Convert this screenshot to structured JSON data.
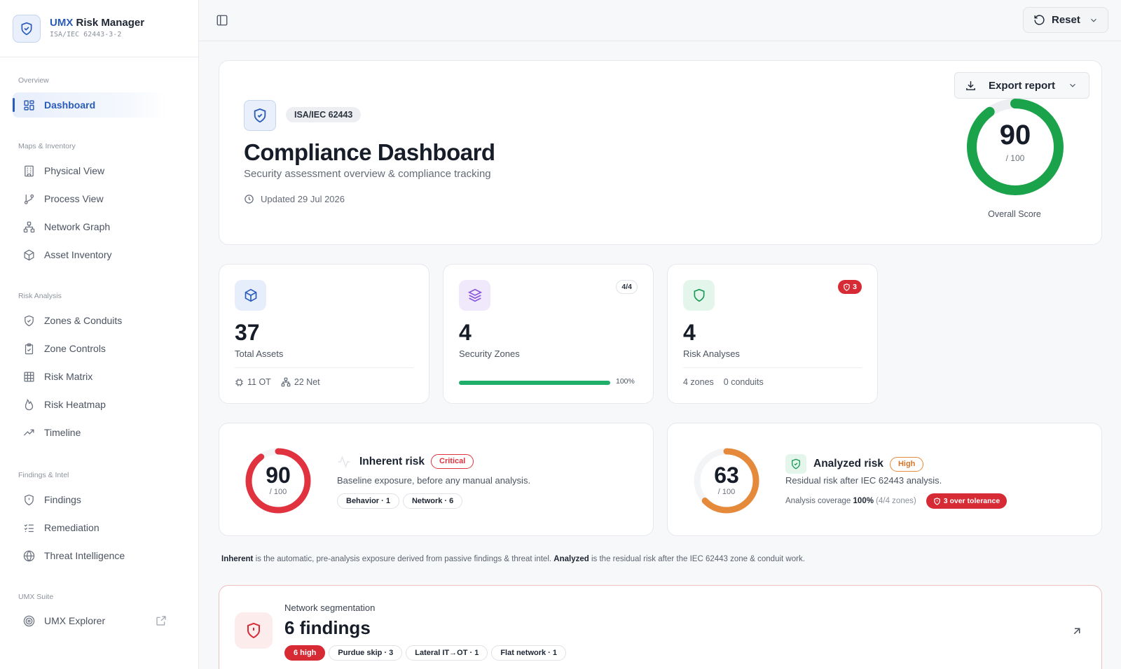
{
  "app": {
    "name_accent": "UMX",
    "name_rest": "Risk Manager",
    "subtitle": "ISA/IEC 62443-3-2"
  },
  "sidebar": {
    "groups": [
      "Overview",
      "Maps & Inventory",
      "Risk Analysis",
      "Findings & Intel",
      "UMX Suite"
    ],
    "items": [
      {
        "label": "Dashboard",
        "icon": "dashboard-icon",
        "active": true
      },
      {
        "label": "Physical View",
        "icon": "building-icon"
      },
      {
        "label": "Process View",
        "icon": "git-branch-icon"
      },
      {
        "label": "Network Graph",
        "icon": "network-icon"
      },
      {
        "label": "Asset Inventory",
        "icon": "box-icon"
      },
      {
        "label": "Zones & Conduits",
        "icon": "shield-icon"
      },
      {
        "label": "Zone Controls",
        "icon": "clipboard-check-icon"
      },
      {
        "label": "Risk Matrix",
        "icon": "grid-icon"
      },
      {
        "label": "Risk Heatmap",
        "icon": "flame-icon"
      },
      {
        "label": "Timeline",
        "icon": "trend-icon"
      },
      {
        "label": "Findings",
        "icon": "shield-alert-icon"
      },
      {
        "label": "Remediation",
        "icon": "checklist-icon"
      },
      {
        "label": "Threat Intelligence",
        "icon": "globe-icon"
      },
      {
        "label": "UMX Explorer",
        "icon": "radar-icon",
        "external": true
      }
    ]
  },
  "topbar": {
    "reset_label": "Reset"
  },
  "hero": {
    "tag": "ISA/IEC 62443",
    "title": "Compliance Dashboard",
    "subtitle": "Security assessment overview & compliance tracking",
    "updated": "Updated 29 Jul 2026",
    "export_label": "Export report",
    "score": 90,
    "score_max": "/ 100",
    "score_label": "Overall Score"
  },
  "stats": [
    {
      "value": "37",
      "label": "Total Assets",
      "foot_ot": "11 OT",
      "foot_net": "22 Net"
    },
    {
      "value": "4",
      "label": "Security Zones",
      "badge": "4/4",
      "progress": 1.0,
      "progress_label": "100%"
    },
    {
      "value": "4",
      "label": "Risk Analyses",
      "badge": "3",
      "foot_zones": "4 zones",
      "foot_conduits": "0 conduits"
    }
  ],
  "inherent": {
    "score": 90,
    "score_max": "/ 100",
    "title": "Inherent risk",
    "severity": "Critical",
    "desc": "Baseline exposure, before any manual analysis.",
    "chips": [
      "Behavior · 1",
      "Network · 6"
    ]
  },
  "analyzed": {
    "score": 63,
    "score_max": "/ 100",
    "title": "Analyzed risk",
    "severity": "High",
    "desc": "Residual risk after IEC 62443 analysis.",
    "coverage_label": "Analysis coverage",
    "coverage_value": "100%",
    "coverage_detail": "(4/4 zones)",
    "tolerance": "3 over tolerance"
  },
  "explain": {
    "term1": "Inherent",
    "text1": " is the automatic, pre-analysis exposure derived from passive findings & threat intel. ",
    "term2": "Analyzed",
    "text2": " is the residual risk after the IEC 62443 zone & conduit work."
  },
  "findings": {
    "category": "Network segmentation",
    "count": "6 findings",
    "severity": "6 high",
    "chips": [
      "Purdue skip · 3",
      "Lateral IT→OT · 1",
      "Flat network · 1"
    ]
  },
  "colors": {
    "accent": "#2a5bb8",
    "success": "#1aa34a",
    "critical": "#e0323f",
    "high": "#e5893a"
  }
}
